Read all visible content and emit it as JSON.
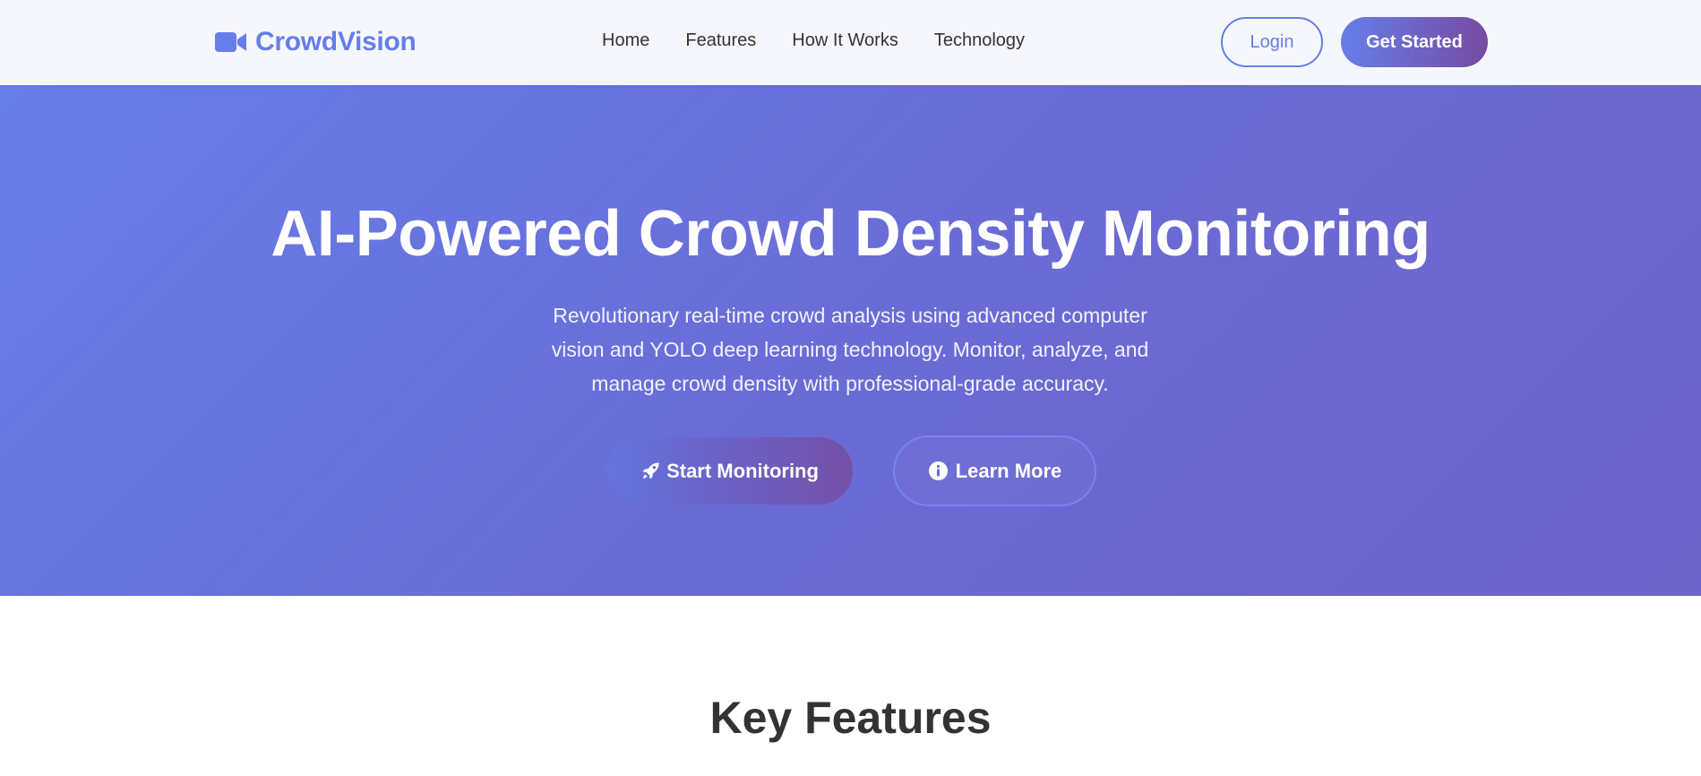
{
  "brand": {
    "name": "CrowdVision",
    "icon": "video-camera-icon"
  },
  "nav": {
    "links": [
      "Home",
      "Features",
      "How It Works",
      "Technology"
    ],
    "login_label": "Login",
    "get_started_label": "Get Started"
  },
  "hero": {
    "title": "AI-Powered Crowd Density Monitoring",
    "subtitle": "Revolutionary real-time crowd analysis using advanced computer vision and YOLO deep learning technology. Monitor, analyze, and manage crowd density with professional-grade accuracy.",
    "start_label": "Start Monitoring",
    "start_icon": "rocket-icon",
    "learn_label": "Learn More",
    "learn_icon": "info-circle-icon"
  },
  "features": {
    "title": "Key Features"
  },
  "colors": {
    "accent": "#667eea",
    "accent_end": "#764ba2",
    "nav_bg": "#f6f7fc",
    "text_dark": "#333333"
  }
}
